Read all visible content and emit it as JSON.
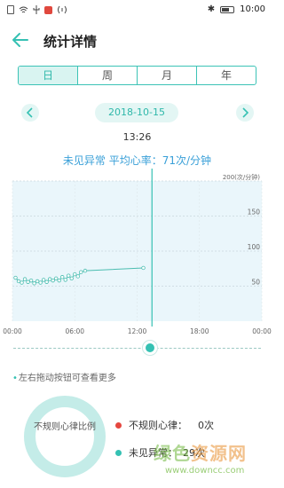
{
  "status_bar": {
    "time": "10:00",
    "icons": [
      "sim-icon",
      "wifi-icon",
      "usb-icon",
      "notification-icon",
      "nfc-icon",
      "bluetooth-icon",
      "battery-icon"
    ]
  },
  "header": {
    "title": "统计详情",
    "back_icon": "arrow-left-icon"
  },
  "tabs": [
    {
      "label": "日",
      "active": true
    },
    {
      "label": "周",
      "active": false
    },
    {
      "label": "月",
      "active": false
    },
    {
      "label": "年",
      "active": false
    }
  ],
  "date_nav": {
    "date": "2018-10-15",
    "prev_icon": "chevron-left-icon",
    "next_icon": "chevron-right-icon"
  },
  "time": "13:26",
  "summary": "未见异常 平均心率：71次/分钟",
  "chart_data": {
    "type": "line",
    "unit_label": "200(次/分钟)",
    "y_ticks": [
      "150",
      "100",
      "50"
    ],
    "x_ticks": [
      "00:00",
      "06:00",
      "12:00",
      "18:00",
      "00:00"
    ],
    "ylim": [
      0,
      200
    ],
    "xlim": [
      0,
      24
    ],
    "series": [
      {
        "x": [
          0.3,
          0.6,
          0.9,
          1.2,
          1.5,
          1.8,
          2.1,
          2.4,
          2.7,
          3.0,
          3.3,
          3.6,
          3.9,
          4.2,
          4.5,
          4.8,
          5.1,
          5.4,
          5.7,
          6.0,
          6.3,
          6.6,
          7.0,
          12.6
        ],
        "y": [
          62,
          57,
          55,
          60,
          56,
          58,
          54,
          57,
          55,
          59,
          56,
          60,
          58,
          61,
          58,
          63,
          59,
          65,
          61,
          67,
          64,
          70,
          72,
          76
        ]
      }
    ],
    "marker_x": 13.43,
    "colors": {
      "line": "#4bbdb0",
      "marker": "#35c1b3",
      "fill": "#eaf6fb"
    }
  },
  "hint": {
    "dot": "•",
    "text": "左右拖动按钮可查看更多"
  },
  "legend": [
    {
      "label": "不规则心律：",
      "value": "0次",
      "color": "#e5473f"
    },
    {
      "label": "未见异常：",
      "value": "29次",
      "color": "#35c1b3"
    }
  ],
  "donut_label": "不规则心律比例",
  "watermark": {
    "text1a": "绿色",
    "text1b": "资源网",
    "text2": "www.downcc.com"
  }
}
